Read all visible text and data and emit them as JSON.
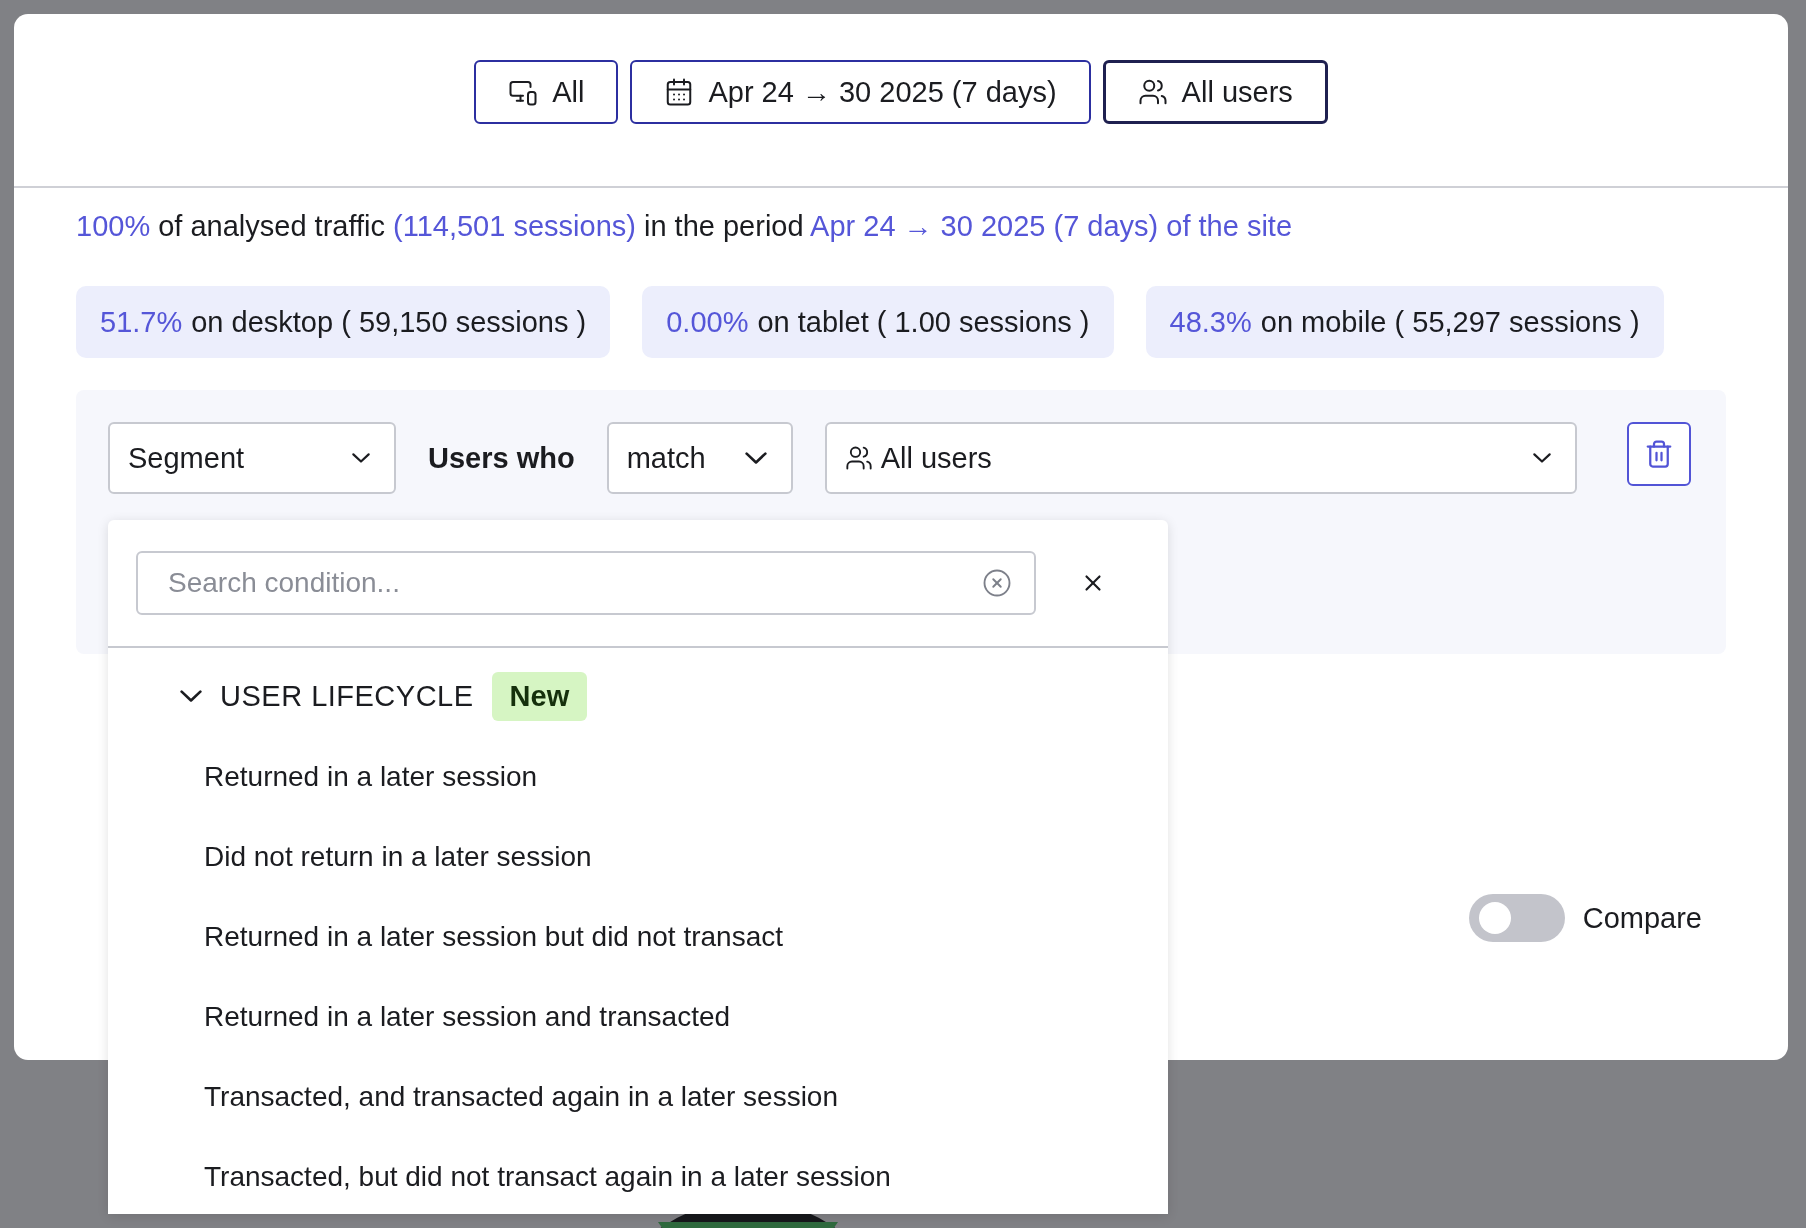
{
  "filters": [
    {
      "kind": "device",
      "label": "All",
      "selected": false
    },
    {
      "kind": "date",
      "label": "Apr 24 → 30 2025 (7 days)",
      "selected": false
    },
    {
      "kind": "users",
      "label": "All users",
      "selected": true
    }
  ],
  "summary": [
    {
      "text": "100%",
      "highlight": true
    },
    {
      "text": " of analysed traffic ",
      "highlight": false
    },
    {
      "text": "(114,501 sessions)",
      "highlight": true
    },
    {
      "text": " in the period ",
      "highlight": false
    },
    {
      "text": "Apr 24 → 30 2025 (7 days) of the site",
      "highlight": true
    }
  ],
  "devices": [
    {
      "share": "51.7%",
      "text": "on desktop ( 59,150 sessions )"
    },
    {
      "share": "0.00%",
      "text": "on tablet ( 1.00 sessions )"
    },
    {
      "share": "48.3%",
      "text": "on mobile ( 55,297 sessions )"
    }
  ],
  "segment": {
    "type": "Segment",
    "connector": "Users who",
    "operator": "match",
    "value": "All users"
  },
  "dropdown": {
    "search_placeholder": "Search condition...",
    "groups": [
      {
        "label": "USER LIFECYCLE",
        "badge": "New",
        "expanded": true,
        "items": [
          "Returned in a later session",
          "Did not return in a later session",
          "Returned in a later session but did not transact",
          "Returned in a later session and transacted",
          "Transacted, and transacted again in a later session",
          "Transacted, but did not transact again in a later session"
        ]
      }
    ]
  },
  "compare": {
    "label": "Compare",
    "on": false
  }
}
